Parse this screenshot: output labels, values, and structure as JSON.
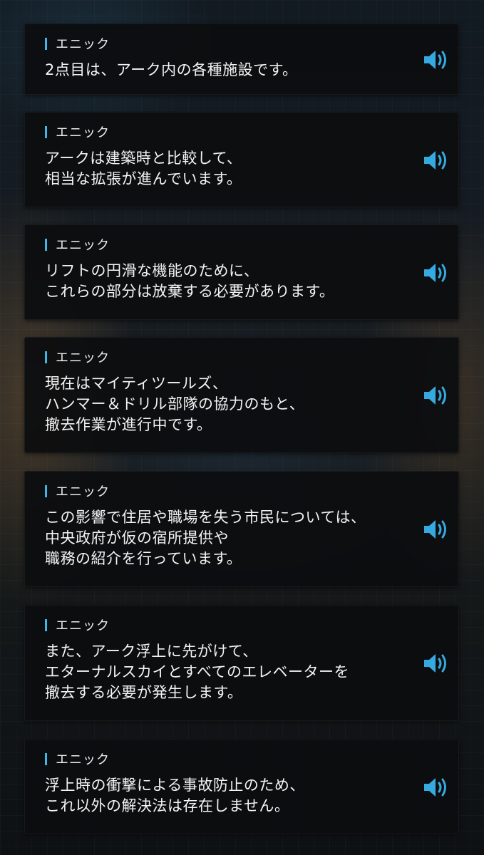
{
  "accent_color": "#3fb6e6",
  "voice_icon": "speaker-volume-icon",
  "entries": [
    {
      "speaker": "エニック",
      "text": "2点目は、アーク内の各種施設です。"
    },
    {
      "speaker": "エニック",
      "text": "アークは建築時と比較して、\n相当な拡張が進んでいます。"
    },
    {
      "speaker": "エニック",
      "text": "リフトの円滑な機能のために、\nこれらの部分は放棄する必要があります。"
    },
    {
      "speaker": "エニック",
      "text": "現在はマイティツールズ、\nハンマー＆ドリル部隊の協力のもと、\n撤去作業が進行中です。"
    },
    {
      "speaker": "エニック",
      "text": "この影響で住居や職場を失う市民については、\n中央政府が仮の宿所提供や\n職務の紹介を行っています。"
    },
    {
      "speaker": "エニック",
      "text": "また、アーク浮上に先がけて、\nエターナルスカイとすべてのエレベーターを\n撤去する必要が発生します。"
    },
    {
      "speaker": "エニック",
      "text": "浮上時の衝撃による事故防止のため、\nこれ以外の解決法は存在しません。"
    }
  ]
}
